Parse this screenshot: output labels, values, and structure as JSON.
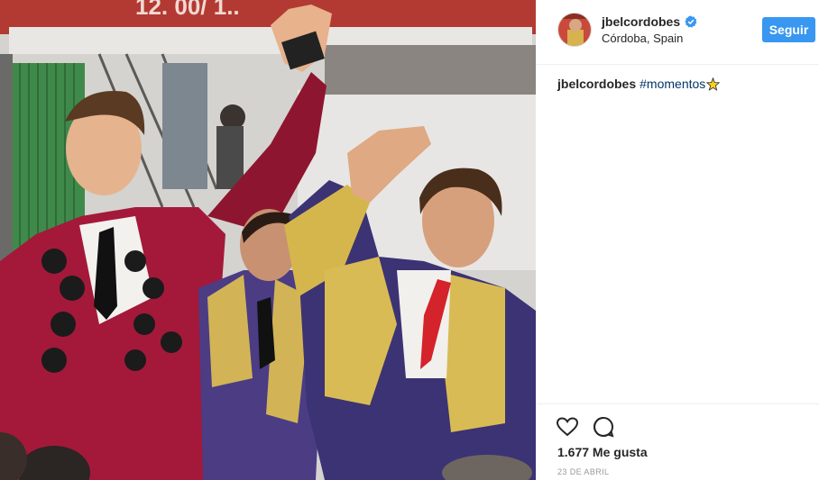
{
  "post": {
    "banner_text": "12. 00/ 1..",
    "photo_desc_icon": "photo-icon"
  },
  "header": {
    "username": "jbelcordobes",
    "location": "Córdoba, Spain",
    "follow_label": "Seguir",
    "verified_icon": "verified-badge-icon",
    "accent": "#3897f0"
  },
  "caption": {
    "username": "jbelcordobes",
    "hashtag": "#momentos"
  },
  "actions": {
    "like_icon": "heart-icon",
    "comment_icon": "comment-icon",
    "likes": "1.677 Me gusta",
    "date": "23 DE ABRIL"
  }
}
